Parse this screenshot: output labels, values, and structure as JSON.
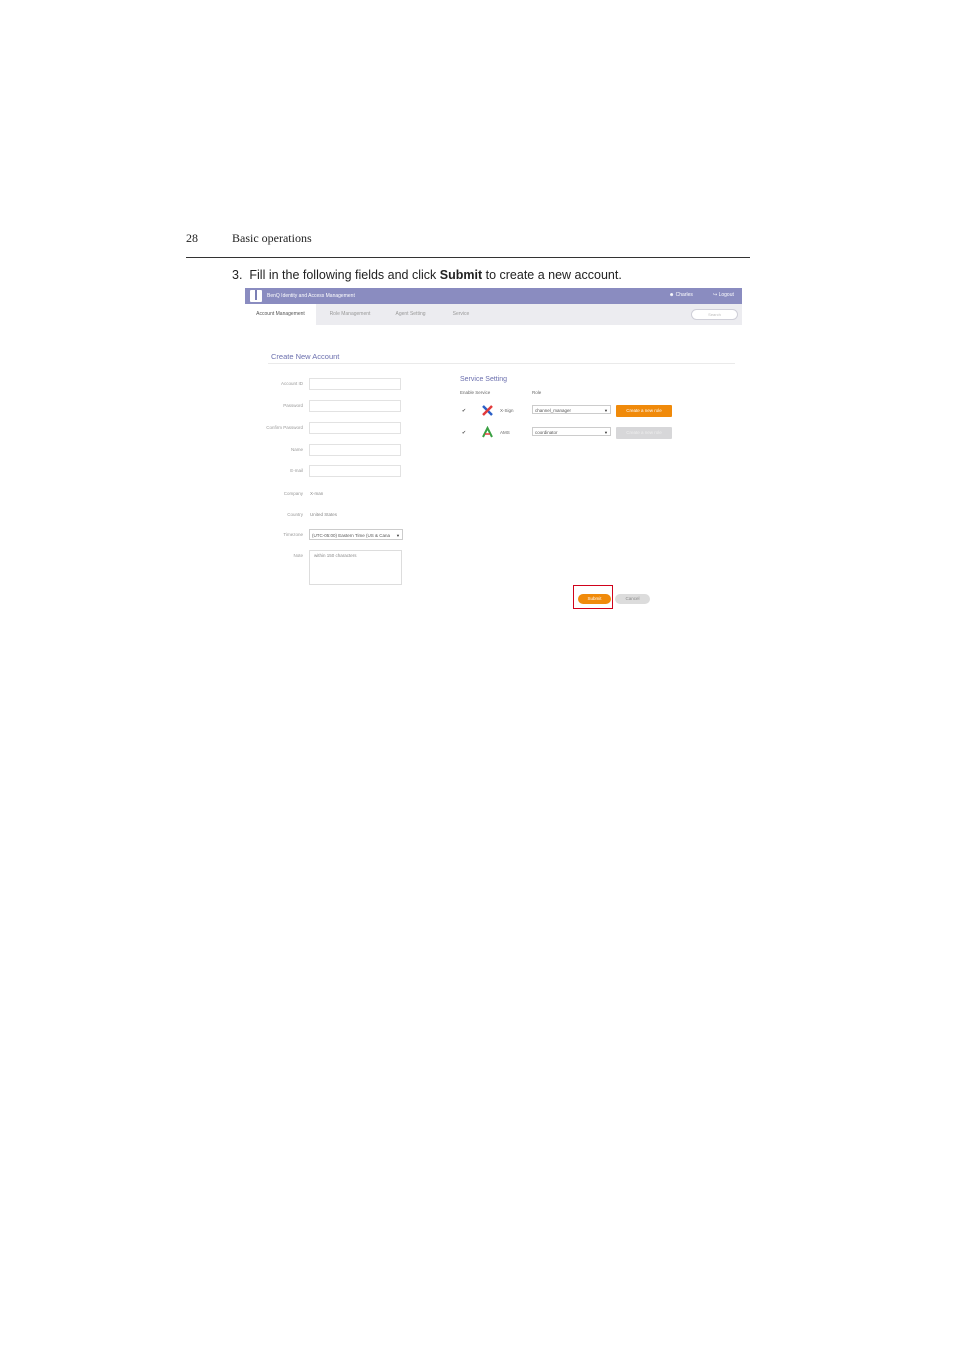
{
  "page": {
    "number": "28",
    "section": "Basic operations",
    "step_number": "3.",
    "step_before": "Fill in the following fields and click",
    "step_bold": "Submit",
    "step_after": "to create a new account."
  },
  "app": {
    "title": "BenQ Identity and Access Management",
    "user": "Charles",
    "logout": "Logout",
    "search_placeholder": "Search"
  },
  "tabs": [
    "Account Management",
    "Role Management",
    "Agent Setting",
    "Service"
  ],
  "form": {
    "title": "Create New Account",
    "labels": {
      "account_id": "Account ID",
      "password": "Password",
      "confirm_password": "Confirm Password",
      "name": "Name",
      "email": "E-mail",
      "company": "Company",
      "country": "Country",
      "timezone": "Timezone",
      "note": "Note"
    },
    "company_value": "X-man",
    "country_value": "United States",
    "timezone_value": "(UTC-05:00) Eastern Time (US & Cana",
    "note_placeholder": "within 150 characters"
  },
  "service": {
    "title": "Service Setting",
    "col_enable": "Enable Service",
    "col_role": "Role",
    "rows": [
      {
        "name": "X-Sign",
        "role": "channel_manager",
        "button": "Create a new role",
        "icon": "xsign-icon"
      },
      {
        "name": "AMS",
        "role": "coordinator",
        "button": "Create a new role",
        "icon": "ams-icon"
      }
    ],
    "check_glyph": "✔"
  },
  "actions": {
    "submit": "Submit",
    "cancel": "Cancel"
  },
  "colors": {
    "header": "#8a8cc0",
    "accent": "#f08a0a",
    "highlight": "#d0021b"
  }
}
